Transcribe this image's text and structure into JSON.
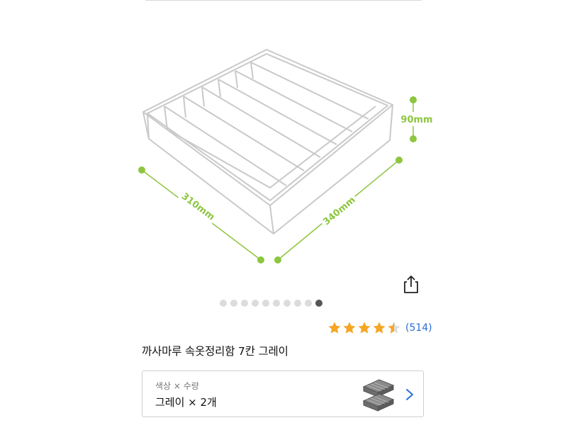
{
  "product": {
    "title": "까사마루 속옷정리함 7칸 그레이",
    "dimensions": {
      "width": "310mm",
      "depth": "340mm",
      "height": "90mm"
    },
    "rating": {
      "value": 4.5,
      "max": 5,
      "count": "(514)"
    },
    "gallery": {
      "total": 10,
      "current": 10
    }
  },
  "option": {
    "label": "색상 × 수량",
    "value": "그레이 × 2개"
  },
  "icons": {
    "share": "share-icon",
    "star": "star-icon",
    "chevron": "chevron-right-icon"
  },
  "colors": {
    "dimension_green": "#8dc63f",
    "star_gold": "#f5a623",
    "link_blue": "#2a6fd6",
    "active_dot": "#555555",
    "inactive_dot": "#dcdcdc"
  }
}
